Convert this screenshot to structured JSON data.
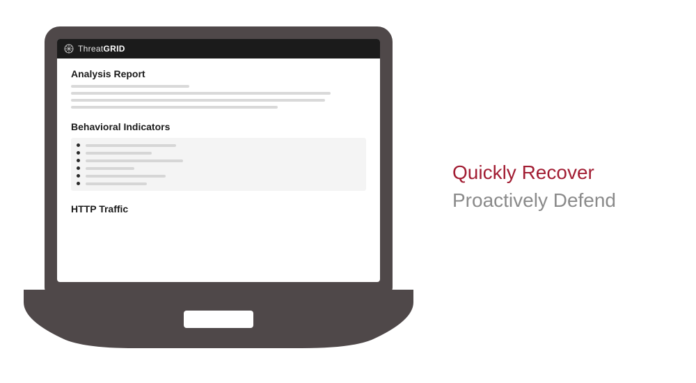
{
  "brand": {
    "light": "Threat",
    "bold": "GRID"
  },
  "sections": {
    "analysis": "Analysis Report",
    "behavioral": "Behavioral Indicators",
    "http": "HTTP Traffic"
  },
  "marketing": {
    "line1": "Quickly Recover",
    "line2": "Proactively Defend"
  }
}
